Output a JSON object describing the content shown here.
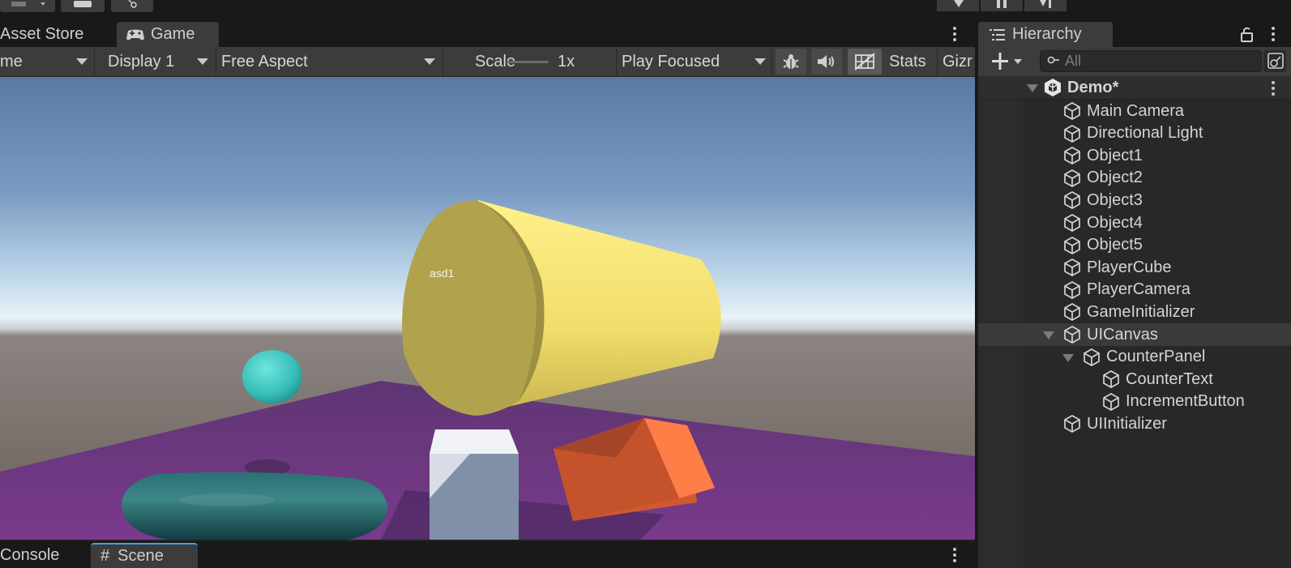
{
  "colors": {
    "accent": "#4a9eda",
    "panel": "#3c3c3c",
    "sky_top": "#5d7ba8",
    "floor": "#6e3580",
    "cylinder": "#f2e16f",
    "sphere": "#3fcbc3",
    "capsule": "#1d5e62",
    "box": "#ff7e48"
  },
  "game_window": {
    "tabs": [
      {
        "label": "Asset Store",
        "active": false
      },
      {
        "label": "Game",
        "active": true,
        "icon": "gamepad-icon"
      }
    ],
    "toolbar": {
      "mode_dropdown": "me",
      "display_dropdown": "Display 1",
      "aspect_dropdown": "Free Aspect",
      "scale_label": "Scale",
      "scale_value": "1x",
      "play_mode_dropdown": "Play Focused",
      "stats_label": "Stats",
      "gizmos_label": "Gizr",
      "icons": [
        "bug-icon",
        "speaker-icon",
        "grid-icon"
      ]
    },
    "viewport": {
      "world_label": "asd1"
    },
    "bottom_tabs": [
      {
        "label": "Console",
        "active": false
      },
      {
        "label": "Scene",
        "active": true,
        "icon": "hash-icon"
      }
    ]
  },
  "hierarchy": {
    "title": "Hierarchy",
    "search_placeholder": "All",
    "scene": {
      "name": "Demo*"
    },
    "items": [
      {
        "label": "Main Camera",
        "depth": 0
      },
      {
        "label": "Directional Light",
        "depth": 0
      },
      {
        "label": "Object1",
        "depth": 0
      },
      {
        "label": "Object2",
        "depth": 0
      },
      {
        "label": "Object3",
        "depth": 0
      },
      {
        "label": "Object4",
        "depth": 0
      },
      {
        "label": "Object5",
        "depth": 0
      },
      {
        "label": "PlayerCube",
        "depth": 0
      },
      {
        "label": "PlayerCamera",
        "depth": 0
      },
      {
        "label": "GameInitializer",
        "depth": 0
      },
      {
        "label": "UICanvas",
        "depth": 0,
        "expanded": true,
        "selected": true
      },
      {
        "label": "CounterPanel",
        "depth": 1,
        "expanded": true
      },
      {
        "label": "CounterText",
        "depth": 2
      },
      {
        "label": "IncrementButton",
        "depth": 2
      },
      {
        "label": "UIInitializer",
        "depth": 0
      }
    ]
  }
}
